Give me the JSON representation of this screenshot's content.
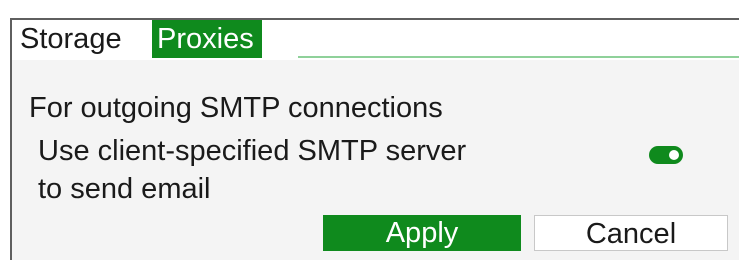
{
  "tabs": {
    "storage_label": "Storage",
    "proxies_label": "Proxies",
    "active": "Proxies"
  },
  "section": {
    "heading": "For outgoing SMTP connections"
  },
  "option": {
    "label_line1": "Use client-specified SMTP server",
    "label_line2": "to send email",
    "enabled": true
  },
  "buttons": {
    "apply_label": "Apply",
    "cancel_label": "Cancel"
  },
  "colors": {
    "accent": "#0f8a1d",
    "tab_underline": "#8fd19a",
    "panel_background": "#f4f4f4"
  }
}
